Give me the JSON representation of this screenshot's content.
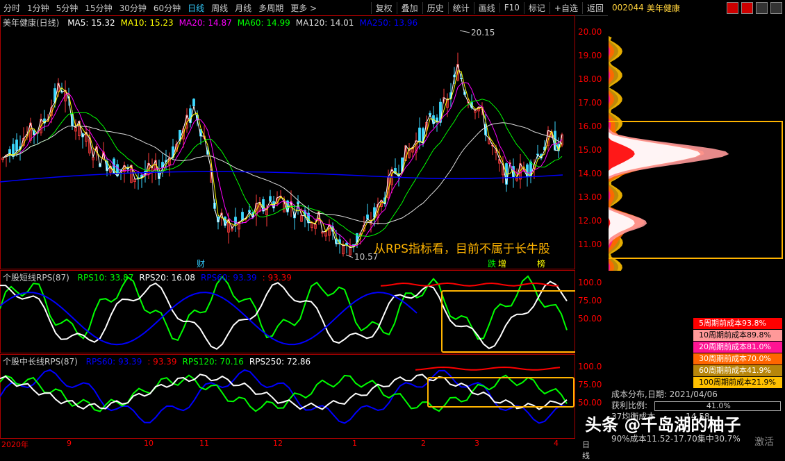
{
  "toolbar": {
    "periods": [
      "分时",
      "1分钟",
      "5分钟",
      "15分钟",
      "30分钟",
      "60分钟",
      "日线",
      "周线",
      "月线",
      "多周期",
      "更多 >"
    ],
    "active": "日线",
    "tools": [
      "复权",
      "叠加",
      "历史",
      "统计",
      "画线",
      "F10",
      "标记",
      "+自选",
      "返回"
    ]
  },
  "stock": {
    "code": "002044",
    "name": "美年健康"
  },
  "main": {
    "title": "美年健康(日线)",
    "ma": [
      {
        "label": "MA5: 15.32",
        "color": "#ffffff"
      },
      {
        "label": "MA10: 15.23",
        "color": "#ffff00"
      },
      {
        "label": "MA20: 14.87",
        "color": "#ff00ff"
      },
      {
        "label": "MA60: 14.99",
        "color": "#00ff00"
      },
      {
        "label": "MA120: 14.01",
        "color": "#dddddd"
      },
      {
        "label": "MA250: 13.96",
        "color": "#0000ff"
      }
    ],
    "high_label": "20.15",
    "low_label": "10.57",
    "markers": [
      "财",
      "跌",
      "增",
      "榜"
    ],
    "annotation": "从RPS指标看，目前不属于长牛股"
  },
  "price_axis": [
    "20.00",
    "19.00",
    "18.00",
    "17.00",
    "16.00",
    "15.00",
    "14.00",
    "13.00",
    "12.00",
    "11.00"
  ],
  "rps_short": {
    "title": "个股短线RPS(87)",
    "items": [
      {
        "label": "RPS10: 33.87",
        "color": "#00ff00"
      },
      {
        "label": "RPS20: 16.08",
        "color": "#ffffff"
      },
      {
        "label": "RPS60: 93.39",
        "color": "#0000ff"
      },
      {
        "label": ": 93.39",
        "color": "#ff0000"
      }
    ],
    "ticks": [
      "100.0",
      "75.00",
      "50.00"
    ]
  },
  "rps_long": {
    "title": "个股中长线RPS(87)",
    "items": [
      {
        "label": "RPS60: 93.39",
        "color": "#0000ff"
      },
      {
        "label": ": 93.39",
        "color": "#ff0000"
      },
      {
        "label": "RPS120: 70.16",
        "color": "#00ff00"
      },
      {
        "label": "RPS250: 72.86",
        "color": "#ffffff"
      }
    ],
    "ticks": [
      "100.0",
      "75.00",
      "50.00"
    ]
  },
  "date_axis": {
    "labels": [
      "2020年",
      "9",
      "10",
      "11",
      "12",
      "1",
      "2",
      "3",
      "4"
    ],
    "period": "日线"
  },
  "cost_legend": [
    {
      "label": "5周期前成本93.8%",
      "color": "#ff0000"
    },
    {
      "label": "10周期前成本89.8%",
      "color": "#ff9999"
    },
    {
      "label": "20周期前成本81.0%",
      "color": "#ff1493"
    },
    {
      "label": "30周期前成本70.0%",
      "color": "#ff6600"
    },
    {
      "label": "60周期前成本41.9%",
      "color": "#b8860b"
    },
    {
      "label": "100周期前成本21.9%",
      "color": "#ffc000"
    }
  ],
  "cost_info": {
    "date_line": "成本分布,日期:  2021/04/06",
    "profit_label": "获利比例:",
    "profit_value": "41.0%",
    "avg_cost": "37均衡成本",
    "avg_val": "14.58",
    "conc": "90%成本11.52-17.70集中30.7%"
  },
  "watermark": "头条 @千岛湖的柚子",
  "activate": "激活"
}
